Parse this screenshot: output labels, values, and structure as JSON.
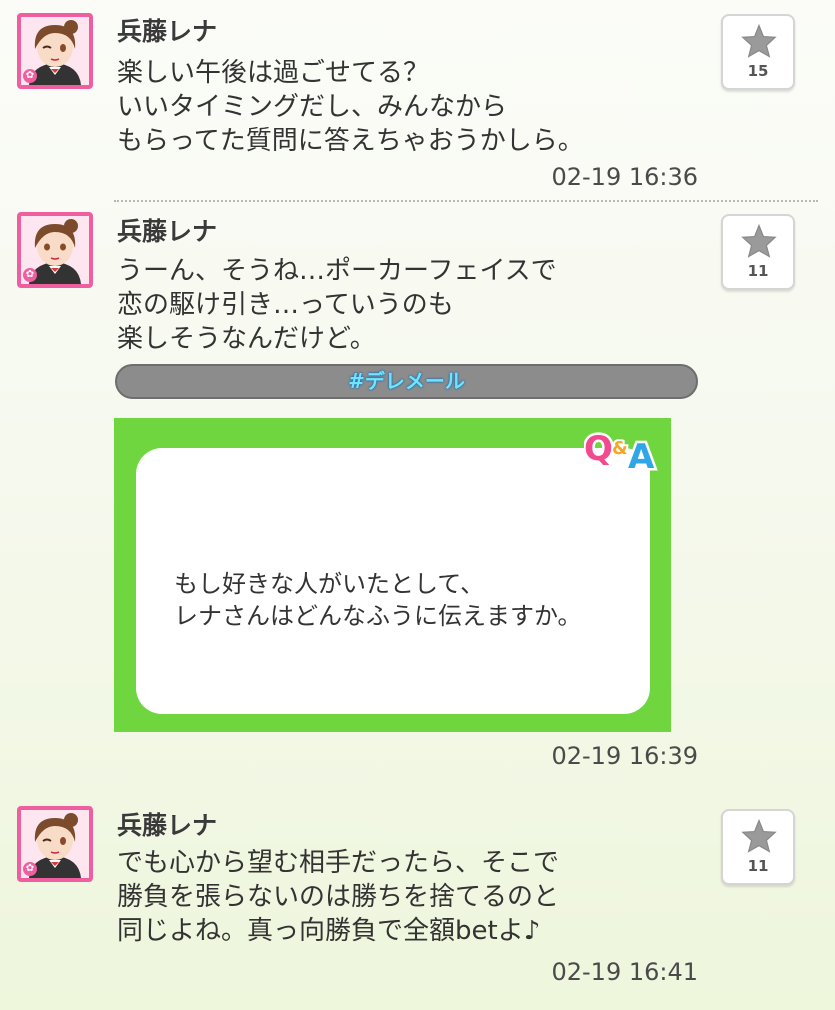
{
  "posts": [
    {
      "author": "兵藤レナ",
      "message": "楽しい午後は過ごせてる？\nいいタイミングだし、みんなから\nもらってた質問に答えちゃおうかしら。",
      "time": "02-19 16:36",
      "favorites": "15"
    },
    {
      "author": "兵藤レナ",
      "message": "うーん、そうね…ポーカーフェイスで\n恋の駆け引き…っていうのも\n楽しそうなんだけど。",
      "tag": "#デレメール",
      "qa_question": "もし好きな人がいたとして、\nレナさんはどんなふうに伝えますか。",
      "qa_logo": "Q&A",
      "time": "02-19 16:39",
      "favorites": "11"
    },
    {
      "author": "兵藤レナ",
      "message": "でも心から望む相手だったら、そこで\n勝負を張らないのは勝ちを捨てるのと\n同じよね。真っ向勝負で全額betよ♪",
      "time": "02-19 16:41",
      "favorites": "11"
    }
  ],
  "icons": {
    "avatar": "character-avatar",
    "favorite": "star-icon",
    "avatar_badge": "flower-icon"
  },
  "colors": {
    "accent_pink": "#ef5f9f",
    "qa_green": "#6fd640",
    "tag_bar": "#8c8c8c",
    "tag_text": "#6fe4ff"
  }
}
